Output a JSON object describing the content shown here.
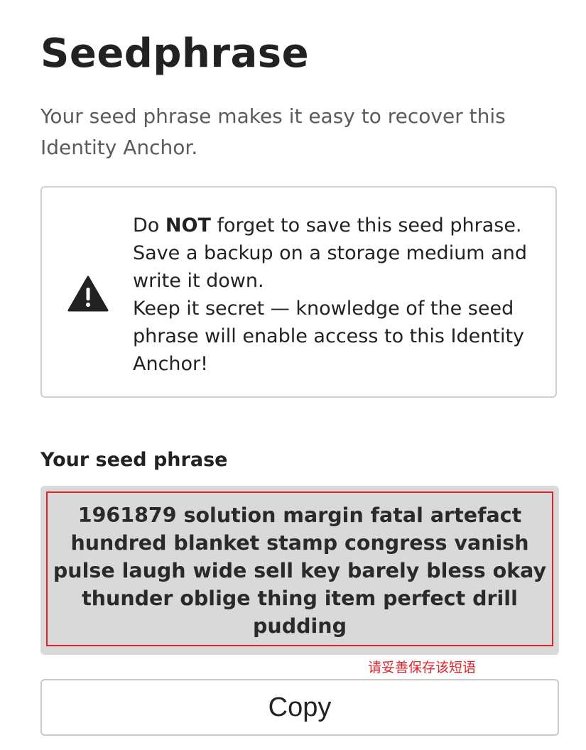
{
  "page": {
    "title": "Seedphrase",
    "subtitle": "Your seed phrase makes it easy to recover this Identity Anchor."
  },
  "warning": {
    "icon": "warning-triangle-icon",
    "text_prefix": "Do ",
    "text_emphasis": "NOT",
    "text_line1_rest": " forget to save this seed phrase. Save a backup on a storage medium and write it down.",
    "text_line2": "Keep it secret — knowledge of the seed phrase will enable access to this Identity Anchor!"
  },
  "seed": {
    "label": "Your seed phrase",
    "phrase": "1961879 solution margin fatal artefact hundred blanket stamp congress vanish pulse laugh wide sell key barely bless okay thunder oblige thing item perfect drill pudding"
  },
  "annotation": {
    "text": "请妥善保存该短语",
    "color": "#e0222a"
  },
  "actions": {
    "copy_label": "Copy"
  },
  "colors": {
    "seed_background": "#d9d9d9",
    "highlight_border": "#e0222a",
    "title": "#222222",
    "subtitle": "#5b5b5b"
  }
}
